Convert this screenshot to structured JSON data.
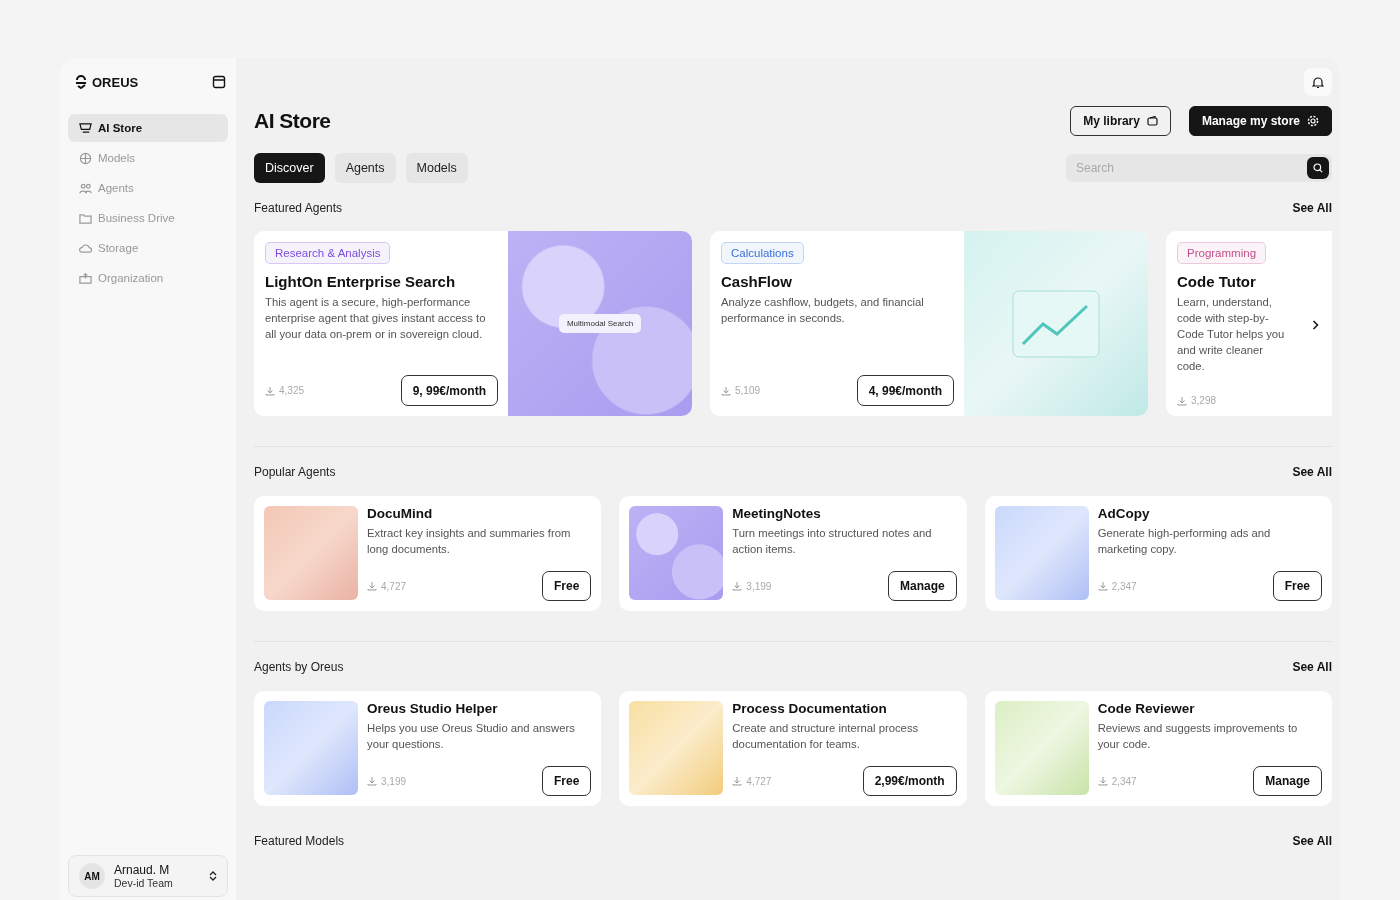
{
  "brand": {
    "name": "OREUS"
  },
  "sidebar": {
    "items": [
      {
        "label": "AI Store",
        "selected": true
      },
      {
        "label": "Models",
        "selected": false
      },
      {
        "label": "Agents",
        "selected": false
      },
      {
        "label": "Business Drive",
        "selected": false
      },
      {
        "label": "Storage",
        "selected": false
      },
      {
        "label": "Organization",
        "selected": false
      }
    ],
    "user": {
      "initials": "AM",
      "name": "Arnaud. M",
      "team": "Dev-id Team"
    }
  },
  "header": {
    "title": "AI Store",
    "buttons": [
      {
        "label": "My library",
        "kind": "outline"
      },
      {
        "label": "Manage my store",
        "kind": "dark"
      }
    ]
  },
  "tabs": [
    {
      "label": "Discover",
      "selected": true
    },
    {
      "label": "Agents",
      "selected": false
    },
    {
      "label": "Models",
      "selected": false
    }
  ],
  "search": {
    "placeholder": "Search"
  },
  "featured_agents": {
    "title": "Featured Agents",
    "see_all": "See All",
    "cards": [
      {
        "tag": "Research & Analysis",
        "color": "#7c4ddb",
        "name": "LightOn Enterprise Search",
        "description": "This agent is a secure, high-performance enterprise agent that gives instant access to all your data on-prem or in sovereign cloud.",
        "downloads": "4,325",
        "price": "9, 99€/month",
        "image_caption": "Multimodal Search"
      },
      {
        "tag": "Calculations",
        "color": "#3b6fd8",
        "name": "CashFlow",
        "description": "Analyze cashflow, budgets, and financial performance in seconds.",
        "downloads": "5,109",
        "price": "4, 99€/month"
      },
      {
        "tag": "Programming",
        "color": "#c0508a",
        "name": "Code Tutor",
        "description": "Learn, understand, code with step-by- Code Tutor helps you and write cleaner code.",
        "downloads": "3,298"
      }
    ]
  },
  "popular_agents": {
    "title": "Popular Agents",
    "see_all": "See All",
    "cards": [
      {
        "name": "DocuMind",
        "description": "Extract key insights and summaries from long documents.",
        "downloads": "4,727",
        "action": "Free"
      },
      {
        "name": "MeetingNotes",
        "description": "Turn meetings into structured notes and action items.",
        "downloads": "3,199",
        "action": "Manage"
      },
      {
        "name": "AdCopy",
        "description": "Generate high-performing ads and marketing copy.",
        "downloads": "2,347",
        "action": "Free"
      }
    ]
  },
  "agents_by_oreus": {
    "title": "Agents by Oreus",
    "see_all": "See All",
    "cards": [
      {
        "name": "Oreus Studio Helper",
        "description": "Helps you use Oreus Studio and answers your questions.",
        "downloads": "3,199",
        "action": "Free"
      },
      {
        "name": "Process Documentation",
        "description": "Create and structure internal process documentation for teams.",
        "downloads": "4,727",
        "action": "2,99€/month"
      },
      {
        "name": "Code Reviewer",
        "description": "Reviews and suggests improvements to your code.",
        "downloads": "2,347",
        "action": "Manage"
      }
    ]
  },
  "featured_models": {
    "title": "Featured Models",
    "see_all": "See All"
  }
}
